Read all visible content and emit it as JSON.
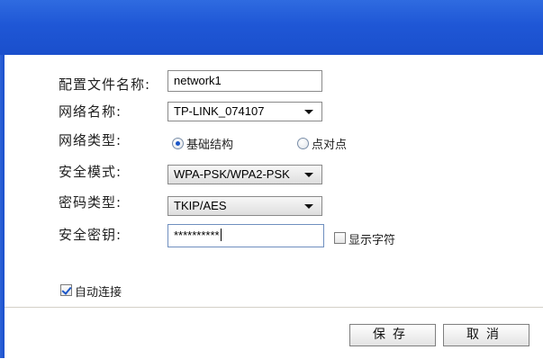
{
  "form": {
    "profile_name_label": "配置文件名称:",
    "profile_name_value": "network1",
    "network_name_label": "网络名称:",
    "network_name_value": "TP-LINK_074107",
    "network_type_label": "网络类型:",
    "network_type_options": [
      {
        "label": "基础结构",
        "selected": true
      },
      {
        "label": "点对点",
        "selected": false
      }
    ],
    "security_mode_label": "安全模式:",
    "security_mode_value": "WPA-PSK/WPA2-PSK",
    "cipher_type_label": "密码类型:",
    "cipher_type_value": "TKIP/AES",
    "security_key_label": "安全密钥:",
    "security_key_value": "**********",
    "show_chars_label": "显示字符",
    "show_chars_checked": false,
    "auto_connect_label": "自动连接",
    "auto_connect_checked": true
  },
  "footer": {
    "save_label": "保存",
    "cancel_label": "取消"
  },
  "colors": {
    "titlebar": "#1f57d6",
    "accent": "#1a56c8"
  }
}
